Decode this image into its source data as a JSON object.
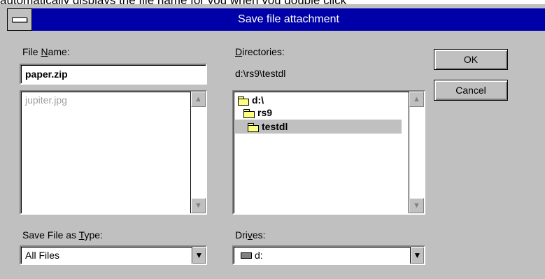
{
  "caption": "automatically displays the file name for you when you double click",
  "window": {
    "title": "Save file attachment"
  },
  "file_name": {
    "label_prefix": "File ",
    "label_underlined": "N",
    "label_suffix": "ame:",
    "value": "paper.zip"
  },
  "file_list": {
    "items": [
      "jupiter.jpg"
    ]
  },
  "directories": {
    "label_underlined": "D",
    "label_suffix": "irectories:",
    "current_path": "d:\\rs9\\testdl",
    "items": [
      {
        "label": "d:\\",
        "icon": "open-folder-icon"
      },
      {
        "label": "rs9",
        "icon": "open-folder-icon"
      },
      {
        "label": "testdl",
        "icon": "open-folder-icon",
        "selected": true
      }
    ]
  },
  "save_type": {
    "label_prefix": "Save File as ",
    "label_underlined": "T",
    "label_suffix": "ype:",
    "selected": "All Files"
  },
  "drives": {
    "label_prefix": "Dri",
    "label_underlined": "v",
    "label_suffix": "es:",
    "selected": "d:"
  },
  "buttons": {
    "ok": "OK",
    "cancel": "Cancel"
  },
  "colors": {
    "title_bar": "#0000a8",
    "dialog_bg": "#c0c0c0",
    "list_bg": "#ffffff",
    "selection": "#c0c0c0"
  }
}
